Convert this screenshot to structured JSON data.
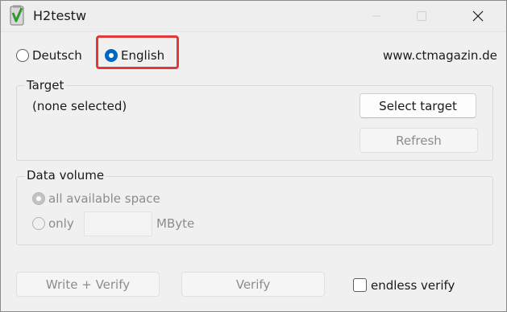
{
  "window": {
    "title": "H2testw",
    "icon": "h2testw-app-icon",
    "controls": [
      "minimize-icon",
      "maximize-icon",
      "close-icon"
    ]
  },
  "language": {
    "options": [
      {
        "label": "Deutsch",
        "selected": false
      },
      {
        "label": "English",
        "selected": true
      }
    ],
    "website": "www.ctmagazin.de"
  },
  "target": {
    "group_label": "Target",
    "selection": "(none selected)",
    "select_button": "Select target",
    "refresh_button": "Refresh"
  },
  "data_volume": {
    "group_label": "Data volume",
    "all_space_label": "all available space",
    "only_label": "only",
    "size_value": "",
    "unit": "MByte"
  },
  "actions": {
    "write_verify_button": "Write + Verify",
    "verify_button": "Verify",
    "endless_verify_label": "endless verify",
    "endless_verify_checked": false
  },
  "colors": {
    "accent": "#0067c0",
    "highlight": "#e0393a"
  }
}
